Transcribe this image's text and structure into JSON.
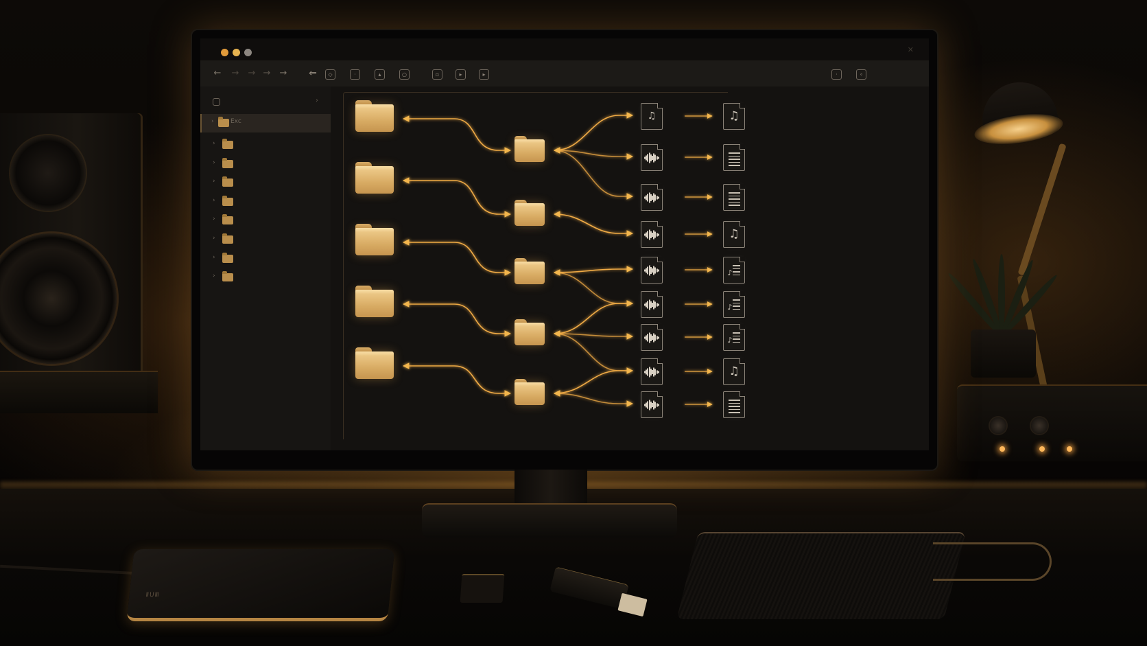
{
  "window": {
    "traffic_lights": [
      "#e19a3a",
      "#e7b350",
      "#8c8680"
    ]
  },
  "toolbar": {
    "nav_glyphs": [
      "←",
      "→",
      "→",
      "→",
      "→"
    ],
    "action_icons": [
      "upload-icon",
      "tag-icon",
      "image-icon",
      "image-icon",
      "refresh-icon",
      "sync-icon",
      "record-icon",
      "media-icon",
      "sidebar-toggle-icon",
      "search-icon"
    ]
  },
  "sidebar": {
    "search_placeholder": "",
    "selected_label": "Exc",
    "items": [
      "",
      "",
      "",
      "",
      "",
      "",
      "",
      ""
    ]
  },
  "diagram": {
    "accent": "#f0b04a",
    "sources": [
      "folder-icon",
      "folder-icon",
      "folder-icon",
      "folder-icon",
      "folder-icon"
    ],
    "hubs": [
      "folder-icon",
      "folder-icon",
      "folder-icon",
      "folder-icon",
      "folder-icon"
    ],
    "files": [
      {
        "type": "audio-music",
        "output": "music-note-icon"
      },
      {
        "type": "waveform",
        "output": "document-lines-icon"
      },
      {
        "type": "waveform",
        "output": "document-lines-icon"
      },
      {
        "type": "waveform",
        "output": "music-note-icon"
      },
      {
        "type": "waveform",
        "output": "music-list-icon"
      },
      {
        "type": "waveform",
        "output": "music-list-icon"
      },
      {
        "type": "waveform",
        "output": "music-list-icon"
      },
      {
        "type": "waveform",
        "output": "music-note-icon"
      },
      {
        "type": "waveform",
        "output": "document-lines-icon"
      }
    ]
  },
  "desk": {
    "drive_label": "ⅡUⅢ"
  }
}
